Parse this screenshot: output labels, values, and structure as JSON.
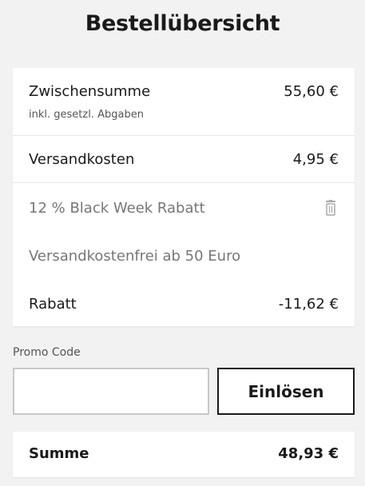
{
  "page": {
    "title": "Bestellübersicht"
  },
  "summary": {
    "subtotal": {
      "label": "Zwischensumme",
      "note": "inkl. gesetzl. Abgaben",
      "value": "55,60 €"
    },
    "shipping": {
      "label": "Versandkosten",
      "value": "4,95 €"
    },
    "promos": [
      {
        "label": "12 % Black Week Rabatt",
        "removable": true,
        "icon": "trash-icon"
      },
      {
        "label": "Versandkostenfrei ab 50 Euro",
        "removable": false
      }
    ],
    "discount": {
      "label": "Rabatt",
      "value": "-11,62 €"
    }
  },
  "promo": {
    "label": "Promo Code",
    "value": "",
    "button_label": "Einlösen"
  },
  "total": {
    "label": "Summe",
    "value": "48,93 €"
  },
  "colors": {
    "background": "#f2f2f2",
    "card": "#ffffff",
    "text": "#1a1a1a",
    "muted": "#777777"
  }
}
